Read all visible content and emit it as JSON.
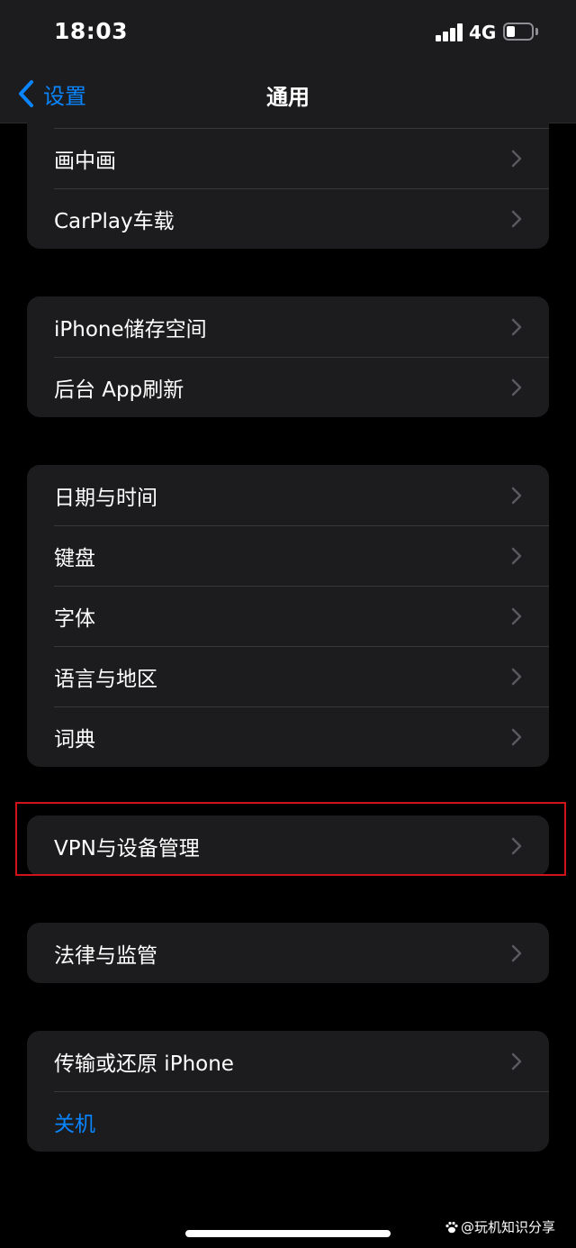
{
  "status_bar": {
    "time": "18:03",
    "network": "4G",
    "signal_icon": "cellular-signal-icon",
    "battery_icon": "battery-icon",
    "battery_level_fraction": 0.35
  },
  "nav": {
    "back_label": "设置",
    "title": "通用"
  },
  "groups": [
    {
      "items": [
        "画中画",
        "CarPlay车载"
      ]
    },
    {
      "items": [
        "iPhone储存空间",
        "后台 App刷新"
      ]
    },
    {
      "items": [
        "日期与时间",
        "键盘",
        "字体",
        "语言与地区",
        "词典"
      ]
    },
    {
      "items": [
        "VPN与设备管理"
      ]
    },
    {
      "items": [
        "法律与监管"
      ]
    },
    {
      "items": [
        "传输或还原 iPhone",
        "关机"
      ]
    }
  ],
  "colors": {
    "background": "#000000",
    "cell": "#1c1c1e",
    "accent": "#0a84ff",
    "highlight": "#d0121b"
  },
  "watermark": "@玩机知识分享"
}
